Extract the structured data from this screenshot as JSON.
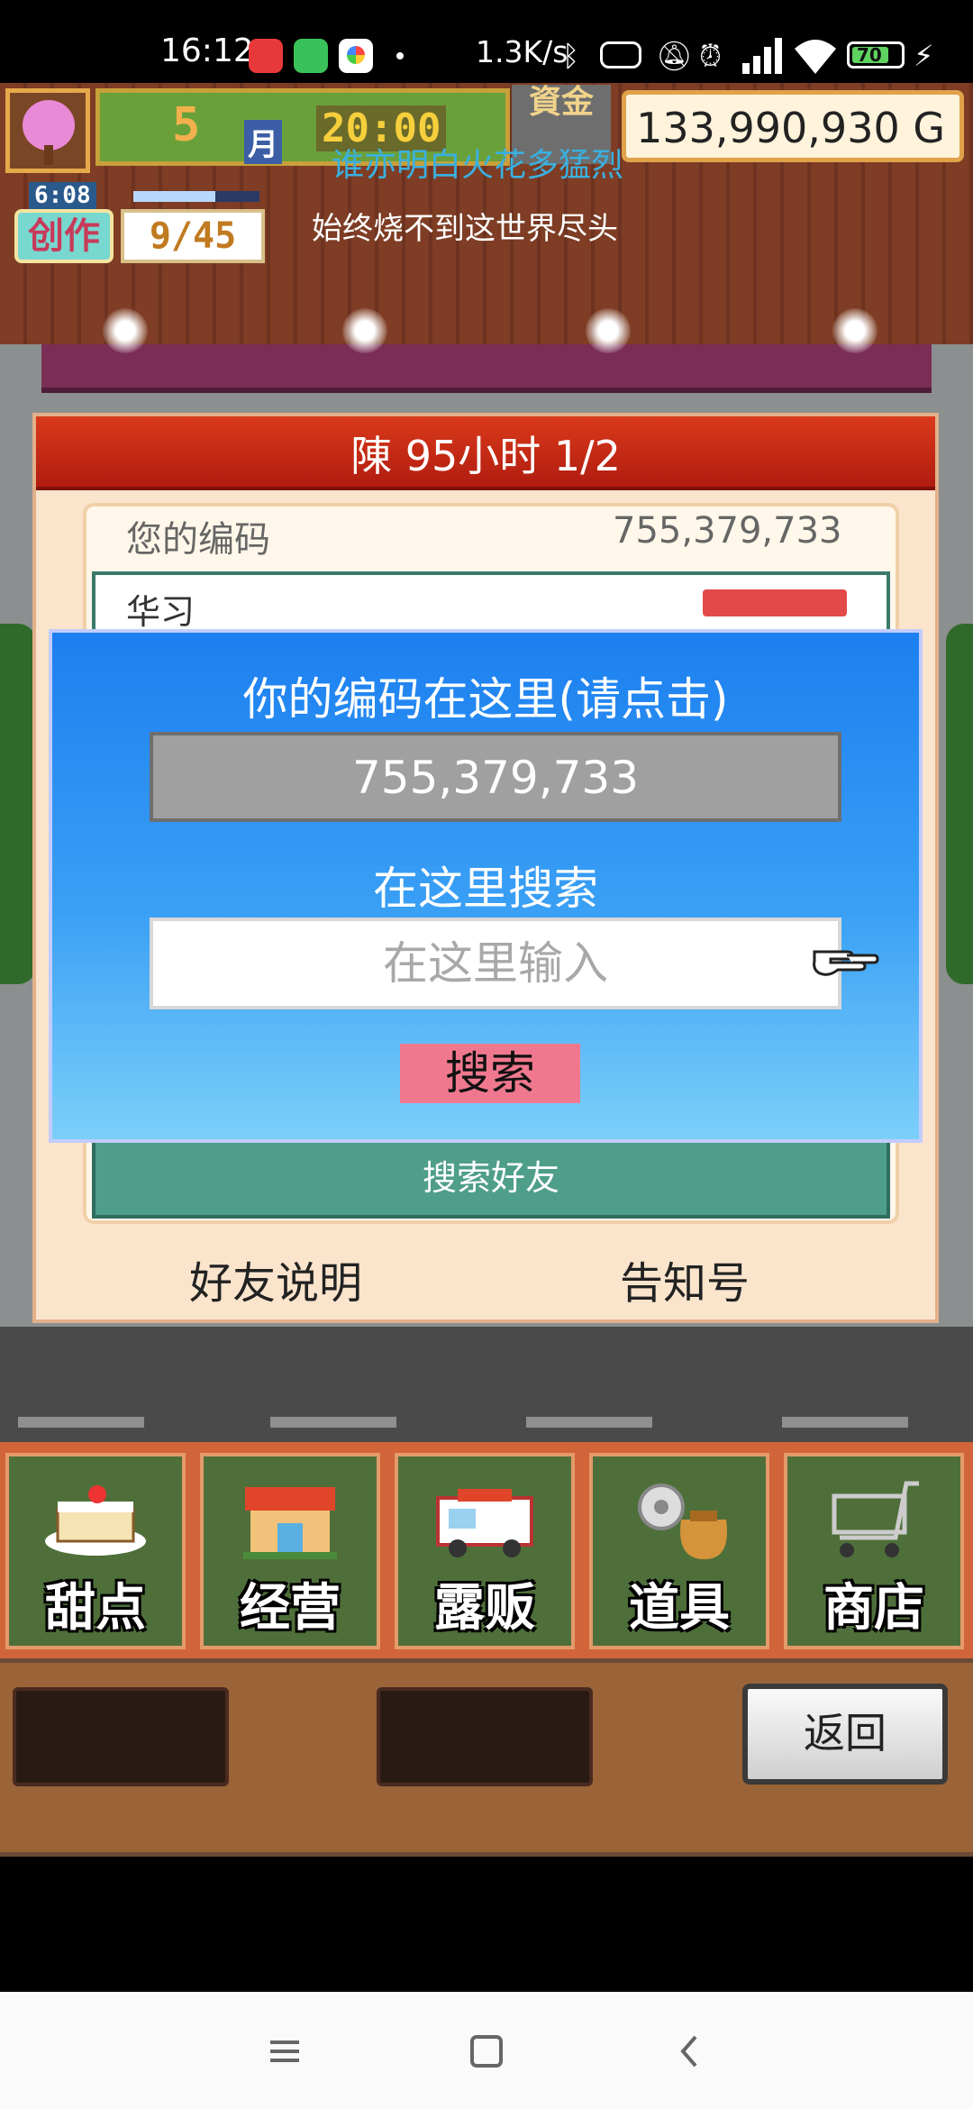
{
  "status_bar": {
    "time": "16:12",
    "network_speed": "1.3K/s",
    "battery_level": "70",
    "icons": [
      "netease-music-icon",
      "wechat-icon",
      "photos-app-icon",
      "dot-icon",
      "bluetooth-icon",
      "vibrate-icon",
      "mute-icon",
      "alarm-icon",
      "hd-signal-icon",
      "wifi-icon",
      "battery-icon",
      "charging-icon"
    ]
  },
  "hud": {
    "month_number": "5",
    "month_label": "月",
    "clock": "20:00",
    "fund_label": "資金",
    "money": "133,990,930 G",
    "overlay_lyric": "谁亦明白火花多猛烈",
    "lyric_line": "始终烧不到这世界尽头",
    "create_timer": "6:08",
    "create_label": "创作",
    "create_count": "9/45",
    "create_progress": 0.65
  },
  "panel": {
    "title": "陳  95小时 1/2",
    "code_label": "您的编码",
    "code_value": "755,379,733",
    "partial_name": "华习",
    "search_friend_label": "搜索好友",
    "friend_help": "好友说明",
    "notice_no": "告知号"
  },
  "dialog": {
    "title": "你的编码在这里(请点击)",
    "code": "755,379,733",
    "search_title": "在这里搜索",
    "search_placeholder": "在这里输入",
    "search_button": "搜索"
  },
  "menu": {
    "items": [
      {
        "label": "甜点",
        "icon": "cake-icon"
      },
      {
        "label": "经营",
        "icon": "shop-icon"
      },
      {
        "label": "露贩",
        "icon": "food-truck-icon"
      },
      {
        "label": "道具",
        "icon": "tools-bag-icon"
      },
      {
        "label": "商店",
        "icon": "cart-icon"
      }
    ],
    "back_label": "返回"
  },
  "nav": [
    "menu-icon",
    "home-icon",
    "back-icon"
  ]
}
